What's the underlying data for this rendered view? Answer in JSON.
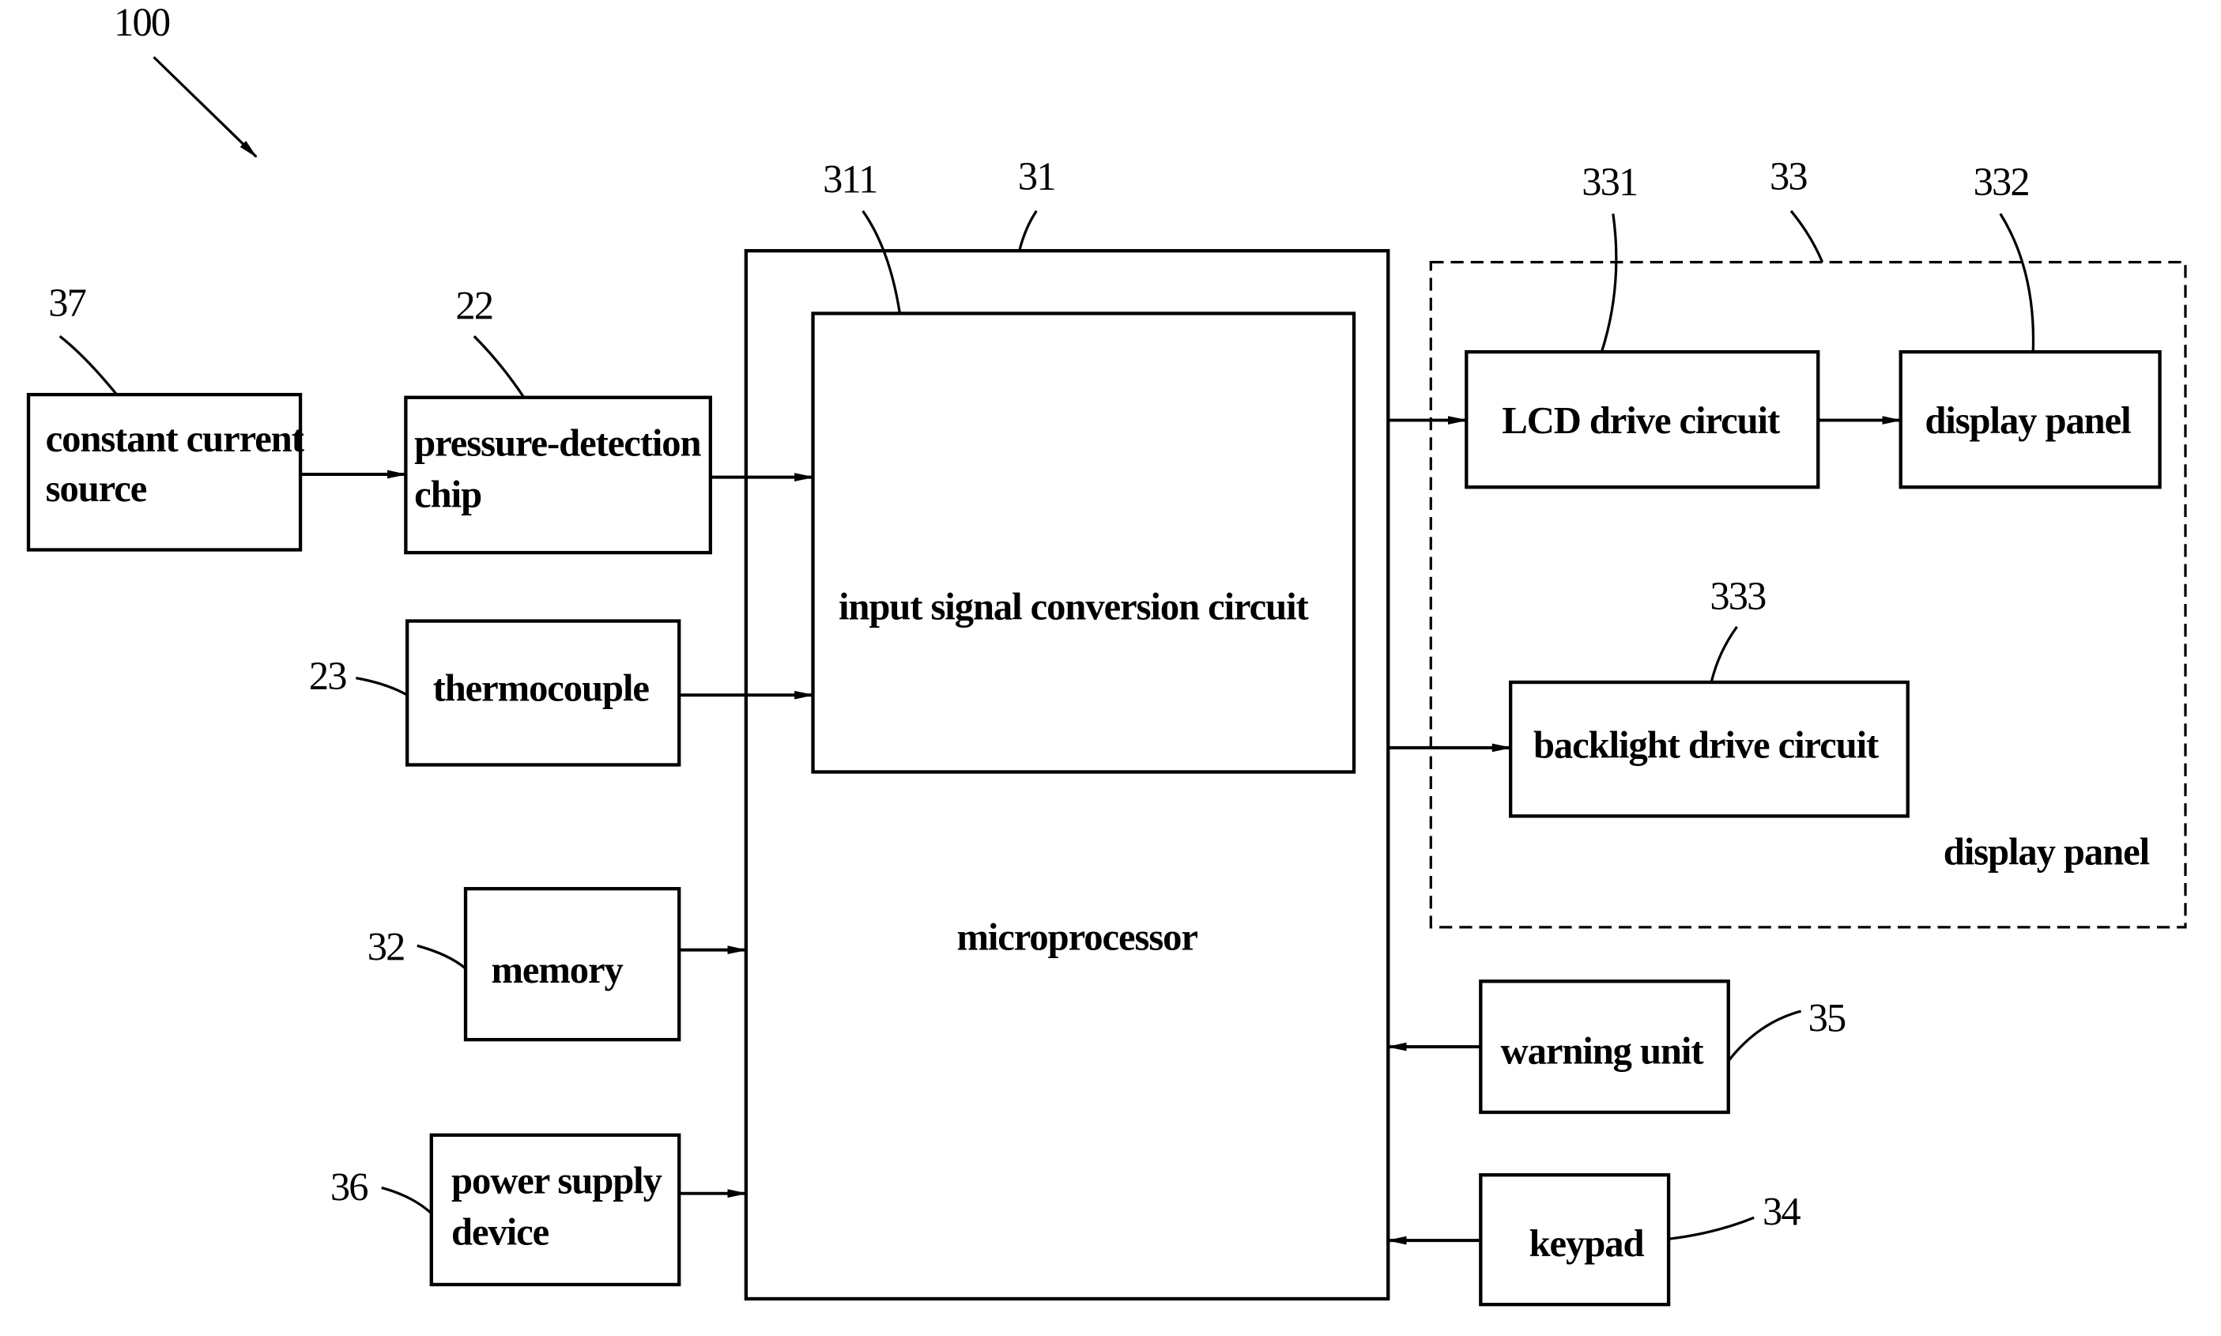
{
  "figure": {
    "reference": "100",
    "blocks": {
      "constant_current_source": {
        "ref": "37",
        "line1": "constant current",
        "line2": "source"
      },
      "pressure_detection_chip": {
        "ref": "22",
        "line1": "pressure-detection",
        "line2": "chip"
      },
      "thermocouple": {
        "ref": "23",
        "label": "thermocouple"
      },
      "memory": {
        "ref": "32",
        "label": "memory"
      },
      "power_supply_device": {
        "ref": "36",
        "line1": "power supply",
        "line2": "device"
      },
      "microprocessor": {
        "ref": "31",
        "label": "microprocessor"
      },
      "input_signal_conversion_circuit": {
        "ref": "311",
        "label": "input signal conversion circuit"
      },
      "display_module": {
        "ref": "33",
        "label": "display panel"
      },
      "lcd_drive_circuit": {
        "ref": "331",
        "label": "LCD drive circuit"
      },
      "display_panel": {
        "ref": "332",
        "label": "display panel"
      },
      "backlight_drive_circuit": {
        "ref": "333",
        "label": "backlight drive circuit"
      },
      "warning_unit": {
        "ref": "35",
        "label": "warning unit"
      },
      "keypad": {
        "ref": "34",
        "label": "keypad"
      }
    },
    "connections": [
      {
        "from": "constant current source",
        "to": "pressure-detection chip"
      },
      {
        "from": "pressure-detection chip",
        "to": "input signal conversion circuit"
      },
      {
        "from": "thermocouple",
        "to": "input signal conversion circuit"
      },
      {
        "from": "memory",
        "to": "microprocessor"
      },
      {
        "from": "power supply device",
        "to": "microprocessor"
      },
      {
        "from": "microprocessor",
        "to": "LCD drive circuit"
      },
      {
        "from": "LCD drive circuit",
        "to": "display panel"
      },
      {
        "from": "microprocessor",
        "to": "backlight drive circuit"
      },
      {
        "from": "warning unit",
        "to": "microprocessor"
      },
      {
        "from": "keypad",
        "to": "microprocessor"
      }
    ]
  }
}
